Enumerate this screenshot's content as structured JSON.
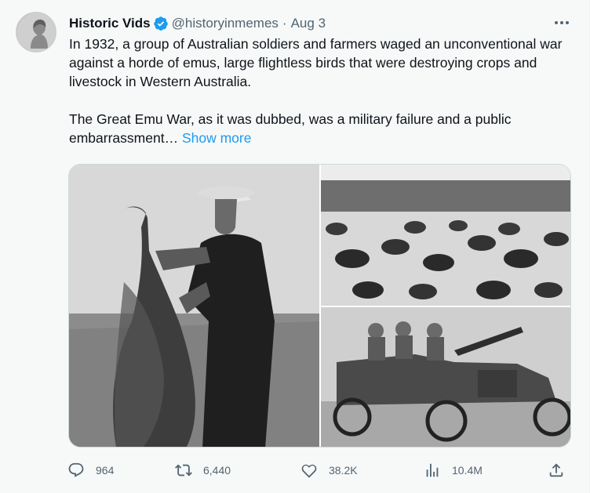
{
  "author": {
    "name": "Historic Vids",
    "handle": "@historyinmemes",
    "separator": "·",
    "date": "Aug 3",
    "avatar_icon": "profile-portrait"
  },
  "tweet": {
    "paragraph1": "In 1932, a group of Australian soldiers and farmers waged an unconventional war against a horde of emus, large flightless birds that were destroying crops and livestock in Western Australia.",
    "paragraph2": "The Great Emu War, as it was dubbed, was a military failure and a public embarrassment… ",
    "show_more": "Show more"
  },
  "media": {
    "photos": [
      {
        "icon": "photo-man-holding-emu"
      },
      {
        "icon": "photo-emus-in-field"
      },
      {
        "icon": "photo-soldiers-in-car-with-gun"
      }
    ]
  },
  "actions": {
    "replies": "964",
    "reposts": "6,440",
    "likes": "38.2K",
    "views": "10.4M"
  },
  "colors": {
    "accent": "#1d9bf0",
    "secondary_text": "#536471",
    "background": "#f7f9f9",
    "verified_badge": "#1d9bf0"
  }
}
